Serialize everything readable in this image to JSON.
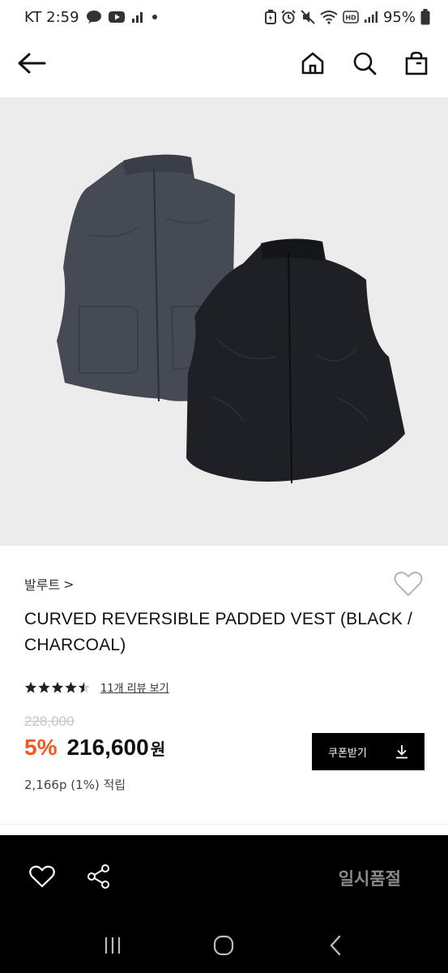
{
  "status_bar": {
    "carrier_time": "KT 2:59",
    "battery": "95%",
    "left_icons": [
      "chat-bubble-icon",
      "youtube-icon",
      "signal-bars-icon",
      "dot-icon"
    ],
    "right_icons": [
      "battery-saver-icon",
      "alarm-icon",
      "mute-icon",
      "wifi-icon",
      "hd-icon",
      "cell-signal-icon",
      "battery-icon"
    ]
  },
  "nav": {
    "icons": [
      "back-arrow-icon",
      "home-icon",
      "search-icon",
      "bag-icon"
    ]
  },
  "product": {
    "brand": "발루트",
    "brand_chevron": ">",
    "title": "CURVED REVERSIBLE PADDED VEST (BLACK / CHARCOAL)",
    "rating_stars": 4.5,
    "review_link": "11개 리뷰 보기",
    "original_price": "228,000",
    "discount": "5%",
    "sale_price": "216,600",
    "currency": "원",
    "points": "2,166p (1%) 적립",
    "coupon_label": "쿠폰받기"
  },
  "bottom_bar": {
    "status_label": "일시품절",
    "icons": [
      "heart-icon",
      "share-icon"
    ]
  },
  "system_nav": {
    "icons": [
      "recent-apps-icon",
      "home-circle-icon",
      "back-chevron-icon"
    ]
  },
  "colors": {
    "accent": "#f05a22",
    "image_bg": "#ececec",
    "bar_bg": "#000000",
    "soldout_text": "#8a8a8a"
  }
}
